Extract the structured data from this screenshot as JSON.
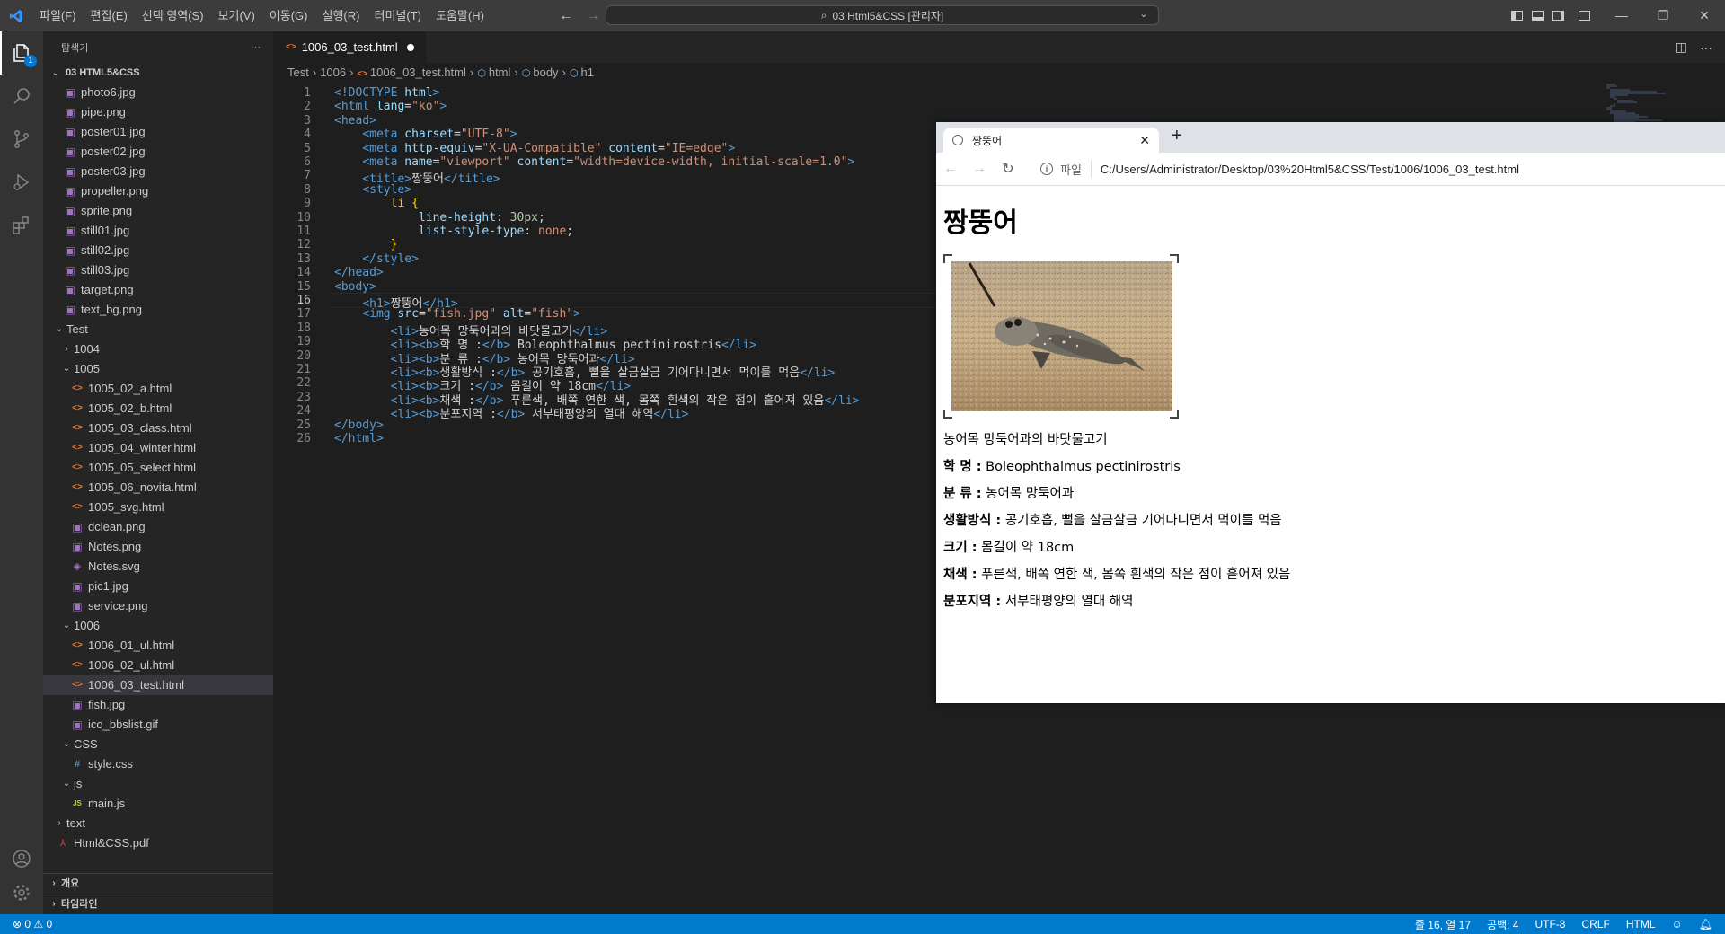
{
  "titlebar": {
    "menu": [
      "파일(F)",
      "편집(E)",
      "선택 영역(S)",
      "보기(V)",
      "이동(G)",
      "실행(R)",
      "터미널(T)",
      "도움말(H)"
    ],
    "command_center": "03 Html5&CSS [관리자]"
  },
  "activity": {
    "explorer_badge": "1"
  },
  "sidebar": {
    "header": "탐색기",
    "more": "···",
    "root": "03 HTML5&CSS",
    "items": [
      {
        "label": "photo6.jpg",
        "type": "img",
        "indent": 2
      },
      {
        "label": "pipe.png",
        "type": "img",
        "indent": 2
      },
      {
        "label": "poster01.jpg",
        "type": "img",
        "indent": 2
      },
      {
        "label": "poster02.jpg",
        "type": "img",
        "indent": 2
      },
      {
        "label": "poster03.jpg",
        "type": "img",
        "indent": 2
      },
      {
        "label": "propeller.png",
        "type": "img",
        "indent": 2
      },
      {
        "label": "sprite.png",
        "type": "img",
        "indent": 2
      },
      {
        "label": "still01.jpg",
        "type": "img",
        "indent": 2
      },
      {
        "label": "still02.jpg",
        "type": "img",
        "indent": 2
      },
      {
        "label": "still03.jpg",
        "type": "img",
        "indent": 2
      },
      {
        "label": "target.png",
        "type": "img",
        "indent": 2
      },
      {
        "label": "text_bg.png",
        "type": "img",
        "indent": 2
      },
      {
        "label": "Test",
        "type": "folder-open",
        "indent": 1
      },
      {
        "label": "1004",
        "type": "folder-closed",
        "indent": 2
      },
      {
        "label": "1005",
        "type": "folder-open",
        "indent": 2
      },
      {
        "label": "1005_02_a.html",
        "type": "html",
        "indent": 3
      },
      {
        "label": "1005_02_b.html",
        "type": "html",
        "indent": 3
      },
      {
        "label": "1005_03_class.html",
        "type": "html",
        "indent": 3
      },
      {
        "label": "1005_04_winter.html",
        "type": "html",
        "indent": 3
      },
      {
        "label": "1005_05_select.html",
        "type": "html",
        "indent": 3
      },
      {
        "label": "1005_06_novita.html",
        "type": "html",
        "indent": 3
      },
      {
        "label": "1005_svg.html",
        "type": "html",
        "indent": 3
      },
      {
        "label": "dclean.png",
        "type": "img",
        "indent": 3
      },
      {
        "label": "Notes.png",
        "type": "img",
        "indent": 3
      },
      {
        "label": "Notes.svg",
        "type": "svg",
        "indent": 3
      },
      {
        "label": "pic1.jpg",
        "type": "img",
        "indent": 3
      },
      {
        "label": "service.png",
        "type": "img",
        "indent": 3
      },
      {
        "label": "1006",
        "type": "folder-open",
        "indent": 2
      },
      {
        "label": "1006_01_ul.html",
        "type": "html",
        "indent": 3
      },
      {
        "label": "1006_02_ul.html",
        "type": "html",
        "indent": 3
      },
      {
        "label": "1006_03_test.html",
        "type": "html",
        "indent": 3,
        "selected": true
      },
      {
        "label": "fish.jpg",
        "type": "img",
        "indent": 3
      },
      {
        "label": "ico_bbslist.gif",
        "type": "img",
        "indent": 3
      },
      {
        "label": "CSS",
        "type": "folder-open",
        "indent": 2
      },
      {
        "label": "style.css",
        "type": "css",
        "indent": 3
      },
      {
        "label": "js",
        "type": "folder-open",
        "indent": 2
      },
      {
        "label": "main.js",
        "type": "js",
        "indent": 3
      },
      {
        "label": "text",
        "type": "folder-closed",
        "indent": 1
      },
      {
        "label": "Html&CSS.pdf",
        "type": "pdf",
        "indent": 1
      }
    ],
    "outline": "개요",
    "timeline": "타임라인"
  },
  "editor": {
    "tab": "1006_03_test.html",
    "breadcrumb": [
      "Test",
      "1006",
      "1006_03_test.html",
      "html",
      "body",
      "h1"
    ],
    "current_line": 16,
    "lines": [
      [
        [
          "t-tag",
          "<!DOCTYPE "
        ],
        [
          "t-att",
          "html"
        ],
        [
          "t-tag",
          ">"
        ]
      ],
      [
        [
          "t-tag",
          "<html "
        ],
        [
          "t-att",
          "lang"
        ],
        [
          "t-txt",
          "="
        ],
        [
          "t-str",
          "\"ko\""
        ],
        [
          "t-tag",
          ">"
        ]
      ],
      [
        [
          "t-tag",
          "<head>"
        ]
      ],
      [
        [
          "t-txt",
          "    "
        ],
        [
          "t-tag",
          "<meta "
        ],
        [
          "t-att",
          "charset"
        ],
        [
          "t-txt",
          "="
        ],
        [
          "t-str",
          "\"UTF-8\""
        ],
        [
          "t-tag",
          ">"
        ]
      ],
      [
        [
          "t-txt",
          "    "
        ],
        [
          "t-tag",
          "<meta "
        ],
        [
          "t-att",
          "http-equiv"
        ],
        [
          "t-txt",
          "="
        ],
        [
          "t-str",
          "\"X-UA-Compatible\""
        ],
        [
          "t-txt",
          " "
        ],
        [
          "t-att",
          "content"
        ],
        [
          "t-txt",
          "="
        ],
        [
          "t-str",
          "\"IE=edge\""
        ],
        [
          "t-tag",
          ">"
        ]
      ],
      [
        [
          "t-txt",
          "    "
        ],
        [
          "t-tag",
          "<meta "
        ],
        [
          "t-att",
          "name"
        ],
        [
          "t-txt",
          "="
        ],
        [
          "t-str",
          "\"viewport\""
        ],
        [
          "t-txt",
          " "
        ],
        [
          "t-att",
          "content"
        ],
        [
          "t-txt",
          "="
        ],
        [
          "t-str",
          "\"width=device-width, initial-scale=1.0\""
        ],
        [
          "t-tag",
          ">"
        ]
      ],
      [
        [
          "t-txt",
          "    "
        ],
        [
          "t-tag",
          "<title>"
        ],
        [
          "t-txt",
          "짱뚱어"
        ],
        [
          "t-tag",
          "</title>"
        ]
      ],
      [
        [
          "t-txt",
          "    "
        ],
        [
          "t-tag",
          "<style>"
        ]
      ],
      [
        [
          "t-txt",
          "        "
        ],
        [
          "t-sel",
          "li "
        ],
        [
          "t-br",
          "{"
        ]
      ],
      [
        [
          "t-txt",
          "            "
        ],
        [
          "t-pr",
          "line-height"
        ],
        [
          "t-txt",
          ": "
        ],
        [
          "t-num",
          "30px"
        ],
        [
          "t-txt",
          ";"
        ]
      ],
      [
        [
          "t-txt",
          "            "
        ],
        [
          "t-pr",
          "list-style-type"
        ],
        [
          "t-txt",
          ": "
        ],
        [
          "t-val",
          "none"
        ],
        [
          "t-txt",
          ";"
        ]
      ],
      [
        [
          "t-txt",
          "        "
        ],
        [
          "t-br",
          "}"
        ]
      ],
      [
        [
          "t-txt",
          "    "
        ],
        [
          "t-tag",
          "</style>"
        ]
      ],
      [
        [
          "t-tag",
          "</head>"
        ]
      ],
      [
        [
          "t-tag",
          "<body>"
        ]
      ],
      [
        [
          "t-txt",
          "    "
        ],
        [
          "t-tag",
          "<h1>"
        ],
        [
          "t-txt",
          "짱뚱어"
        ],
        [
          "t-tag",
          "</h1>"
        ]
      ],
      [
        [
          "t-txt",
          "    "
        ],
        [
          "t-tag",
          "<img "
        ],
        [
          "t-att",
          "src"
        ],
        [
          "t-txt",
          "="
        ],
        [
          "t-str",
          "\"fish.jpg\""
        ],
        [
          "t-txt",
          " "
        ],
        [
          "t-att",
          "alt"
        ],
        [
          "t-txt",
          "="
        ],
        [
          "t-str",
          "\"fish\""
        ],
        [
          "t-tag",
          ">"
        ]
      ],
      [
        [
          "t-txt",
          "        "
        ],
        [
          "t-tag",
          "<li>"
        ],
        [
          "t-txt",
          "농어목 망둑어과의 바닷물고기"
        ],
        [
          "t-tag",
          "</li>"
        ]
      ],
      [
        [
          "t-txt",
          "        "
        ],
        [
          "t-tag",
          "<li><b>"
        ],
        [
          "t-txt",
          "학 명 :"
        ],
        [
          "t-tag",
          "</b>"
        ],
        [
          "t-txt",
          " Boleophthalmus pectinirostris"
        ],
        [
          "t-tag",
          "</li>"
        ]
      ],
      [
        [
          "t-txt",
          "        "
        ],
        [
          "t-tag",
          "<li><b>"
        ],
        [
          "t-txt",
          "분 류 :"
        ],
        [
          "t-tag",
          "</b>"
        ],
        [
          "t-txt",
          " 농어목 망둑어과"
        ],
        [
          "t-tag",
          "</li>"
        ]
      ],
      [
        [
          "t-txt",
          "        "
        ],
        [
          "t-tag",
          "<li><b>"
        ],
        [
          "t-txt",
          "생활방식 :"
        ],
        [
          "t-tag",
          "</b>"
        ],
        [
          "t-txt",
          " 공기호흡, 뻘을 살금살금 기어다니면서 먹이를 먹음"
        ],
        [
          "t-tag",
          "</li>"
        ]
      ],
      [
        [
          "t-txt",
          "        "
        ],
        [
          "t-tag",
          "<li><b>"
        ],
        [
          "t-txt",
          "크기 :"
        ],
        [
          "t-tag",
          "</b>"
        ],
        [
          "t-txt",
          " 몸길이 약 18cm"
        ],
        [
          "t-tag",
          "</li>"
        ]
      ],
      [
        [
          "t-txt",
          "        "
        ],
        [
          "t-tag",
          "<li><b>"
        ],
        [
          "t-txt",
          "채색 :"
        ],
        [
          "t-tag",
          "</b>"
        ],
        [
          "t-txt",
          " 푸른색, 배쪽 연한 색, 몸쪽 흰색의 작은 점이 흩어져 있음"
        ],
        [
          "t-tag",
          "</li>"
        ]
      ],
      [
        [
          "t-txt",
          "        "
        ],
        [
          "t-tag",
          "<li><b>"
        ],
        [
          "t-txt",
          "분포지역 :"
        ],
        [
          "t-tag",
          "</b>"
        ],
        [
          "t-txt",
          " 서부태평양의 열대 해역"
        ],
        [
          "t-tag",
          "</li>"
        ]
      ],
      [
        [
          "t-tag",
          "</body>"
        ]
      ],
      [
        [
          "t-tag",
          "</html>"
        ]
      ]
    ]
  },
  "browser": {
    "tab_title": "짱뚱어",
    "scheme": "파일",
    "url": "C:/Users/Administrator/Desktop/03%20Html5&CSS/Test/1006/1006_03_test.html",
    "heading": "짱뚱어",
    "image_alt": "fish",
    "list": [
      {
        "b": "",
        "t": "농어목 망둑어과의 바닷물고기"
      },
      {
        "b": "학 명 :",
        "t": " Boleophthalmus pectinirostris"
      },
      {
        "b": "분 류 :",
        "t": " 농어목 망둑어과"
      },
      {
        "b": "생활방식 :",
        "t": " 공기호흡, 뻘을 살금살금 기어다니면서 먹이를 먹음"
      },
      {
        "b": "크기 :",
        "t": " 몸길이 약 18cm"
      },
      {
        "b": "채색 :",
        "t": " 푸른색, 배쪽 연한 색, 몸쪽 흰색의 작은 점이 흩어져 있음"
      },
      {
        "b": "분포지역 :",
        "t": " 서부태평양의 열대 해역"
      }
    ]
  },
  "statusbar": {
    "problems": "⊗ 0 ⚠ 0",
    "position": "줄 16, 열 17",
    "spaces": "공백: 4",
    "encoding": "UTF-8",
    "eol": "CRLF",
    "language": "HTML"
  },
  "colors": {
    "accent": "#007acc",
    "titlebar": "#3c3c3c",
    "sidebar": "#252526",
    "editor": "#1e1e1e"
  }
}
